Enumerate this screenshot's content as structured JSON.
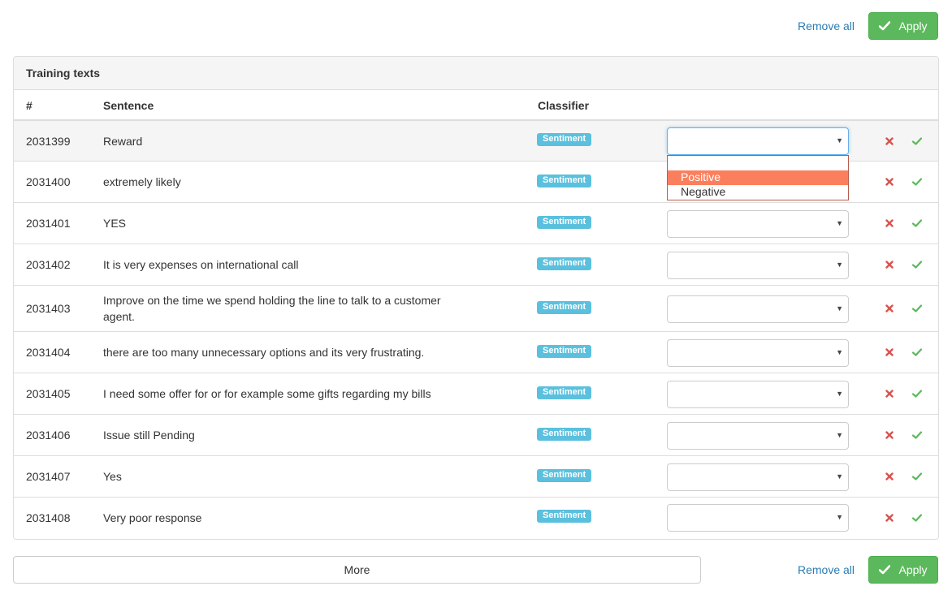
{
  "toolbar": {
    "remove_all_label": "Remove all",
    "apply_label": "Apply"
  },
  "panel": {
    "title": "Training texts",
    "columns": {
      "id": "#",
      "sentence": "Sentence",
      "classifier": "Classifier"
    }
  },
  "rows": [
    {
      "id": "2031399",
      "sentence": "Reward",
      "classifier": "Sentiment",
      "selected": ""
    },
    {
      "id": "2031400",
      "sentence": "extremely likely",
      "classifier": "Sentiment",
      "selected": ""
    },
    {
      "id": "2031401",
      "sentence": "YES",
      "classifier": "Sentiment",
      "selected": ""
    },
    {
      "id": "2031402",
      "sentence": "It is very expenses on international call",
      "classifier": "Sentiment",
      "selected": ""
    },
    {
      "id": "2031403",
      "sentence": "Improve on the time we spend holding the line to talk to a customer agent.",
      "classifier": "Sentiment",
      "selected": ""
    },
    {
      "id": "2031404",
      "sentence": "there are too many unnecessary options and its very frustrating.",
      "classifier": "Sentiment",
      "selected": ""
    },
    {
      "id": "2031405",
      "sentence": "I need some offer for or for example some gifts regarding my bills",
      "classifier": "Sentiment",
      "selected": ""
    },
    {
      "id": "2031406",
      "sentence": "Issue still Pending",
      "classifier": "Sentiment",
      "selected": ""
    },
    {
      "id": "2031407",
      "sentence": "Yes",
      "classifier": "Sentiment",
      "selected": ""
    },
    {
      "id": "2031408",
      "sentence": "Very poor response",
      "classifier": "Sentiment",
      "selected": ""
    }
  ],
  "dropdown": {
    "options": [
      "",
      "Positive",
      "Negative"
    ],
    "highlighted": "Positive"
  },
  "footer": {
    "more_label": "More",
    "remove_all_label": "Remove all",
    "apply_label": "Apply"
  },
  "colors": {
    "apply": "#5cb85c",
    "badge": "#5bc0de",
    "remove": "#d9534f",
    "accept": "#5cb85c",
    "dropdown_highlight": "#fb7f5d",
    "link": "#2a7cb5"
  },
  "icons": {
    "remove": "times-icon",
    "accept": "check-icon",
    "apply": "check-icon",
    "select": "caret-down-icon"
  }
}
